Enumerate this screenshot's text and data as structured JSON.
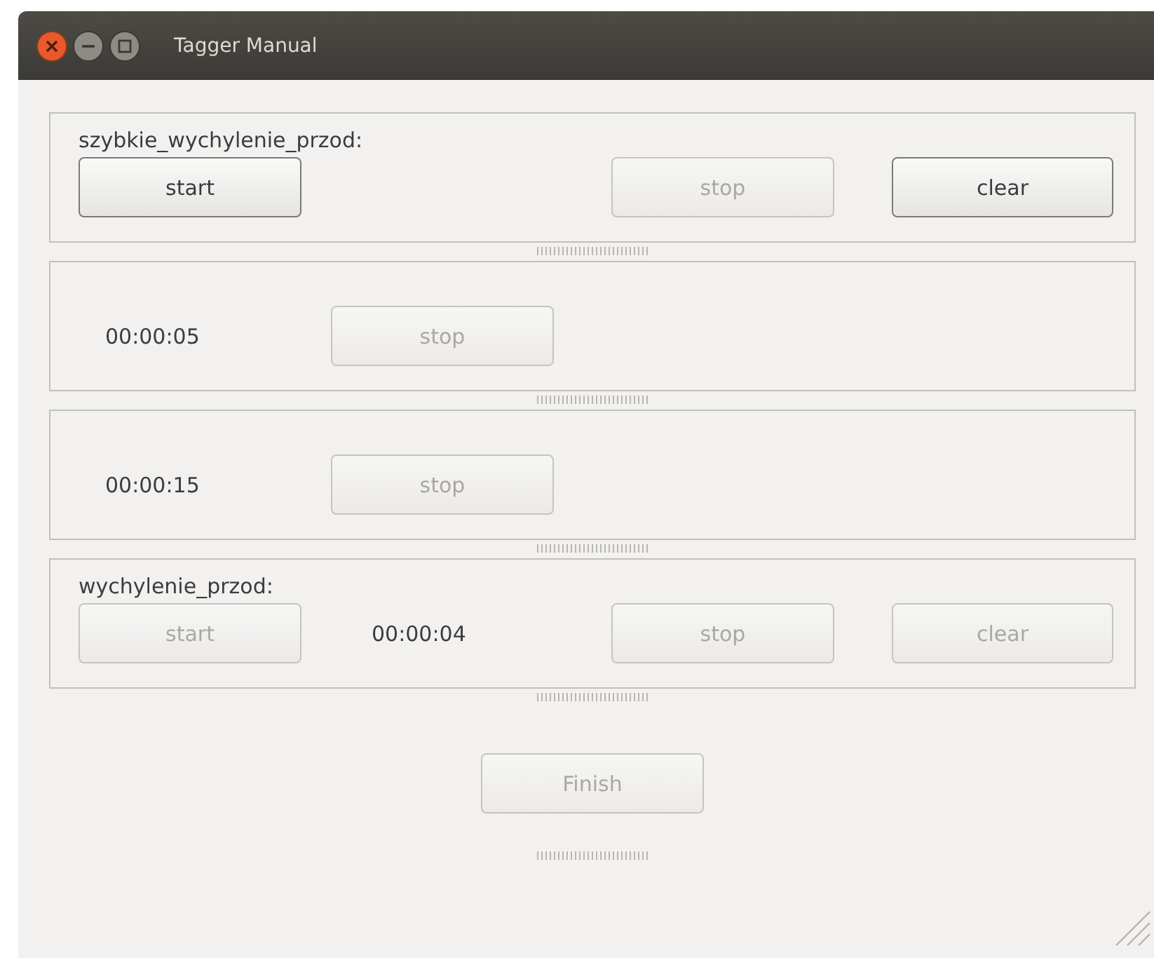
{
  "window": {
    "title": "Tagger Manual"
  },
  "panels": [
    {
      "label": "szybkie_wychylenie_przod:",
      "start": {
        "label": "start",
        "disabled": false
      },
      "stop": {
        "label": "stop",
        "disabled": true
      },
      "clear": {
        "label": "clear",
        "disabled": false
      }
    },
    {
      "time": "00:00:05",
      "stop": {
        "label": "stop",
        "disabled": true
      }
    },
    {
      "time": "00:00:15",
      "stop": {
        "label": "stop",
        "disabled": true
      }
    },
    {
      "label": "wychylenie_przod:",
      "start": {
        "label": "start",
        "disabled": true
      },
      "time": "00:00:04",
      "stop": {
        "label": "stop",
        "disabled": true
      },
      "clear": {
        "label": "clear",
        "disabled": true
      }
    }
  ],
  "finish": {
    "label": "Finish",
    "disabled": true
  }
}
